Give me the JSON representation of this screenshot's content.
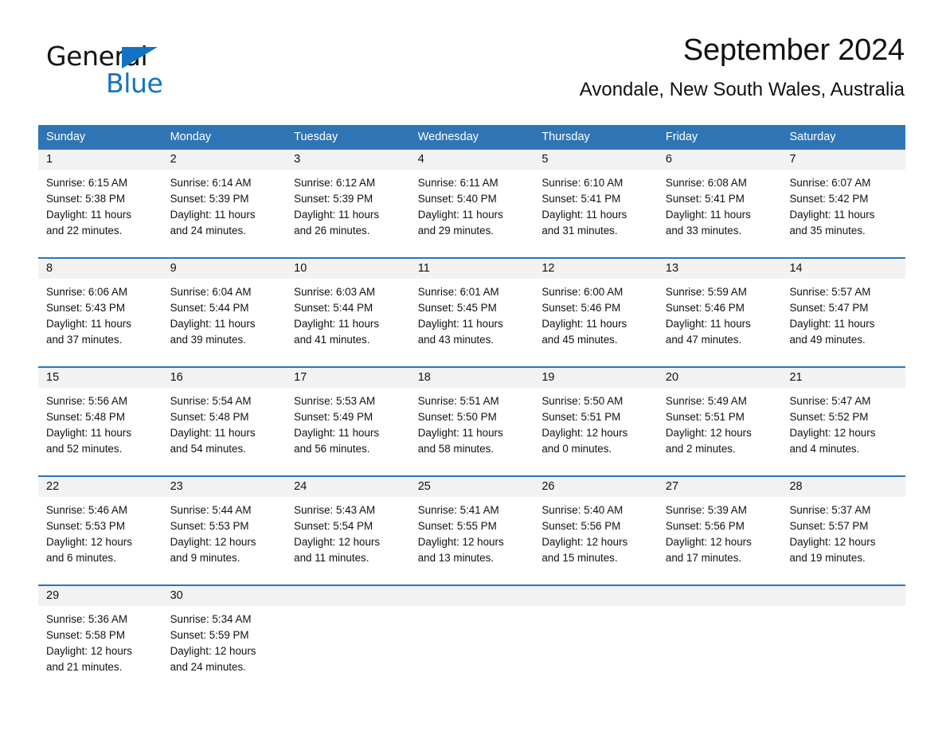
{
  "brand": {
    "name_part1": "General",
    "name_part2": "Blue",
    "accent_color": "#1273c4"
  },
  "header": {
    "month_title": "September 2024",
    "location": "Avondale, New South Wales, Australia"
  },
  "calendar": {
    "header_bg": "#2f75b5",
    "daynum_bg": "#f2f2f2",
    "weekdays": [
      "Sunday",
      "Monday",
      "Tuesday",
      "Wednesday",
      "Thursday",
      "Friday",
      "Saturday"
    ],
    "weeks": [
      [
        {
          "day": "1",
          "sunrise": "Sunrise: 6:15 AM",
          "sunset": "Sunset: 5:38 PM",
          "daylight_line1": "Daylight: 11 hours",
          "daylight_line2": "and 22 minutes."
        },
        {
          "day": "2",
          "sunrise": "Sunrise: 6:14 AM",
          "sunset": "Sunset: 5:39 PM",
          "daylight_line1": "Daylight: 11 hours",
          "daylight_line2": "and 24 minutes."
        },
        {
          "day": "3",
          "sunrise": "Sunrise: 6:12 AM",
          "sunset": "Sunset: 5:39 PM",
          "daylight_line1": "Daylight: 11 hours",
          "daylight_line2": "and 26 minutes."
        },
        {
          "day": "4",
          "sunrise": "Sunrise: 6:11 AM",
          "sunset": "Sunset: 5:40 PM",
          "daylight_line1": "Daylight: 11 hours",
          "daylight_line2": "and 29 minutes."
        },
        {
          "day": "5",
          "sunrise": "Sunrise: 6:10 AM",
          "sunset": "Sunset: 5:41 PM",
          "daylight_line1": "Daylight: 11 hours",
          "daylight_line2": "and 31 minutes."
        },
        {
          "day": "6",
          "sunrise": "Sunrise: 6:08 AM",
          "sunset": "Sunset: 5:41 PM",
          "daylight_line1": "Daylight: 11 hours",
          "daylight_line2": "and 33 minutes."
        },
        {
          "day": "7",
          "sunrise": "Sunrise: 6:07 AM",
          "sunset": "Sunset: 5:42 PM",
          "daylight_line1": "Daylight: 11 hours",
          "daylight_line2": "and 35 minutes."
        }
      ],
      [
        {
          "day": "8",
          "sunrise": "Sunrise: 6:06 AM",
          "sunset": "Sunset: 5:43 PM",
          "daylight_line1": "Daylight: 11 hours",
          "daylight_line2": "and 37 minutes."
        },
        {
          "day": "9",
          "sunrise": "Sunrise: 6:04 AM",
          "sunset": "Sunset: 5:44 PM",
          "daylight_line1": "Daylight: 11 hours",
          "daylight_line2": "and 39 minutes."
        },
        {
          "day": "10",
          "sunrise": "Sunrise: 6:03 AM",
          "sunset": "Sunset: 5:44 PM",
          "daylight_line1": "Daylight: 11 hours",
          "daylight_line2": "and 41 minutes."
        },
        {
          "day": "11",
          "sunrise": "Sunrise: 6:01 AM",
          "sunset": "Sunset: 5:45 PM",
          "daylight_line1": "Daylight: 11 hours",
          "daylight_line2": "and 43 minutes."
        },
        {
          "day": "12",
          "sunrise": "Sunrise: 6:00 AM",
          "sunset": "Sunset: 5:46 PM",
          "daylight_line1": "Daylight: 11 hours",
          "daylight_line2": "and 45 minutes."
        },
        {
          "day": "13",
          "sunrise": "Sunrise: 5:59 AM",
          "sunset": "Sunset: 5:46 PM",
          "daylight_line1": "Daylight: 11 hours",
          "daylight_line2": "and 47 minutes."
        },
        {
          "day": "14",
          "sunrise": "Sunrise: 5:57 AM",
          "sunset": "Sunset: 5:47 PM",
          "daylight_line1": "Daylight: 11 hours",
          "daylight_line2": "and 49 minutes."
        }
      ],
      [
        {
          "day": "15",
          "sunrise": "Sunrise: 5:56 AM",
          "sunset": "Sunset: 5:48 PM",
          "daylight_line1": "Daylight: 11 hours",
          "daylight_line2": "and 52 minutes."
        },
        {
          "day": "16",
          "sunrise": "Sunrise: 5:54 AM",
          "sunset": "Sunset: 5:48 PM",
          "daylight_line1": "Daylight: 11 hours",
          "daylight_line2": "and 54 minutes."
        },
        {
          "day": "17",
          "sunrise": "Sunrise: 5:53 AM",
          "sunset": "Sunset: 5:49 PM",
          "daylight_line1": "Daylight: 11 hours",
          "daylight_line2": "and 56 minutes."
        },
        {
          "day": "18",
          "sunrise": "Sunrise: 5:51 AM",
          "sunset": "Sunset: 5:50 PM",
          "daylight_line1": "Daylight: 11 hours",
          "daylight_line2": "and 58 minutes."
        },
        {
          "day": "19",
          "sunrise": "Sunrise: 5:50 AM",
          "sunset": "Sunset: 5:51 PM",
          "daylight_line1": "Daylight: 12 hours",
          "daylight_line2": "and 0 minutes."
        },
        {
          "day": "20",
          "sunrise": "Sunrise: 5:49 AM",
          "sunset": "Sunset: 5:51 PM",
          "daylight_line1": "Daylight: 12 hours",
          "daylight_line2": "and 2 minutes."
        },
        {
          "day": "21",
          "sunrise": "Sunrise: 5:47 AM",
          "sunset": "Sunset: 5:52 PM",
          "daylight_line1": "Daylight: 12 hours",
          "daylight_line2": "and 4 minutes."
        }
      ],
      [
        {
          "day": "22",
          "sunrise": "Sunrise: 5:46 AM",
          "sunset": "Sunset: 5:53 PM",
          "daylight_line1": "Daylight: 12 hours",
          "daylight_line2": "and 6 minutes."
        },
        {
          "day": "23",
          "sunrise": "Sunrise: 5:44 AM",
          "sunset": "Sunset: 5:53 PM",
          "daylight_line1": "Daylight: 12 hours",
          "daylight_line2": "and 9 minutes."
        },
        {
          "day": "24",
          "sunrise": "Sunrise: 5:43 AM",
          "sunset": "Sunset: 5:54 PM",
          "daylight_line1": "Daylight: 12 hours",
          "daylight_line2": "and 11 minutes."
        },
        {
          "day": "25",
          "sunrise": "Sunrise: 5:41 AM",
          "sunset": "Sunset: 5:55 PM",
          "daylight_line1": "Daylight: 12 hours",
          "daylight_line2": "and 13 minutes."
        },
        {
          "day": "26",
          "sunrise": "Sunrise: 5:40 AM",
          "sunset": "Sunset: 5:56 PM",
          "daylight_line1": "Daylight: 12 hours",
          "daylight_line2": "and 15 minutes."
        },
        {
          "day": "27",
          "sunrise": "Sunrise: 5:39 AM",
          "sunset": "Sunset: 5:56 PM",
          "daylight_line1": "Daylight: 12 hours",
          "daylight_line2": "and 17 minutes."
        },
        {
          "day": "28",
          "sunrise": "Sunrise: 5:37 AM",
          "sunset": "Sunset: 5:57 PM",
          "daylight_line1": "Daylight: 12 hours",
          "daylight_line2": "and 19 minutes."
        }
      ],
      [
        {
          "day": "29",
          "sunrise": "Sunrise: 5:36 AM",
          "sunset": "Sunset: 5:58 PM",
          "daylight_line1": "Daylight: 12 hours",
          "daylight_line2": "and 21 minutes."
        },
        {
          "day": "30",
          "sunrise": "Sunrise: 5:34 AM",
          "sunset": "Sunset: 5:59 PM",
          "daylight_line1": "Daylight: 12 hours",
          "daylight_line2": "and 24 minutes."
        },
        {
          "day": "",
          "sunrise": "",
          "sunset": "",
          "daylight_line1": "",
          "daylight_line2": ""
        },
        {
          "day": "",
          "sunrise": "",
          "sunset": "",
          "daylight_line1": "",
          "daylight_line2": ""
        },
        {
          "day": "",
          "sunrise": "",
          "sunset": "",
          "daylight_line1": "",
          "daylight_line2": ""
        },
        {
          "day": "",
          "sunrise": "",
          "sunset": "",
          "daylight_line1": "",
          "daylight_line2": ""
        },
        {
          "day": "",
          "sunrise": "",
          "sunset": "",
          "daylight_line1": "",
          "daylight_line2": ""
        }
      ]
    ]
  }
}
